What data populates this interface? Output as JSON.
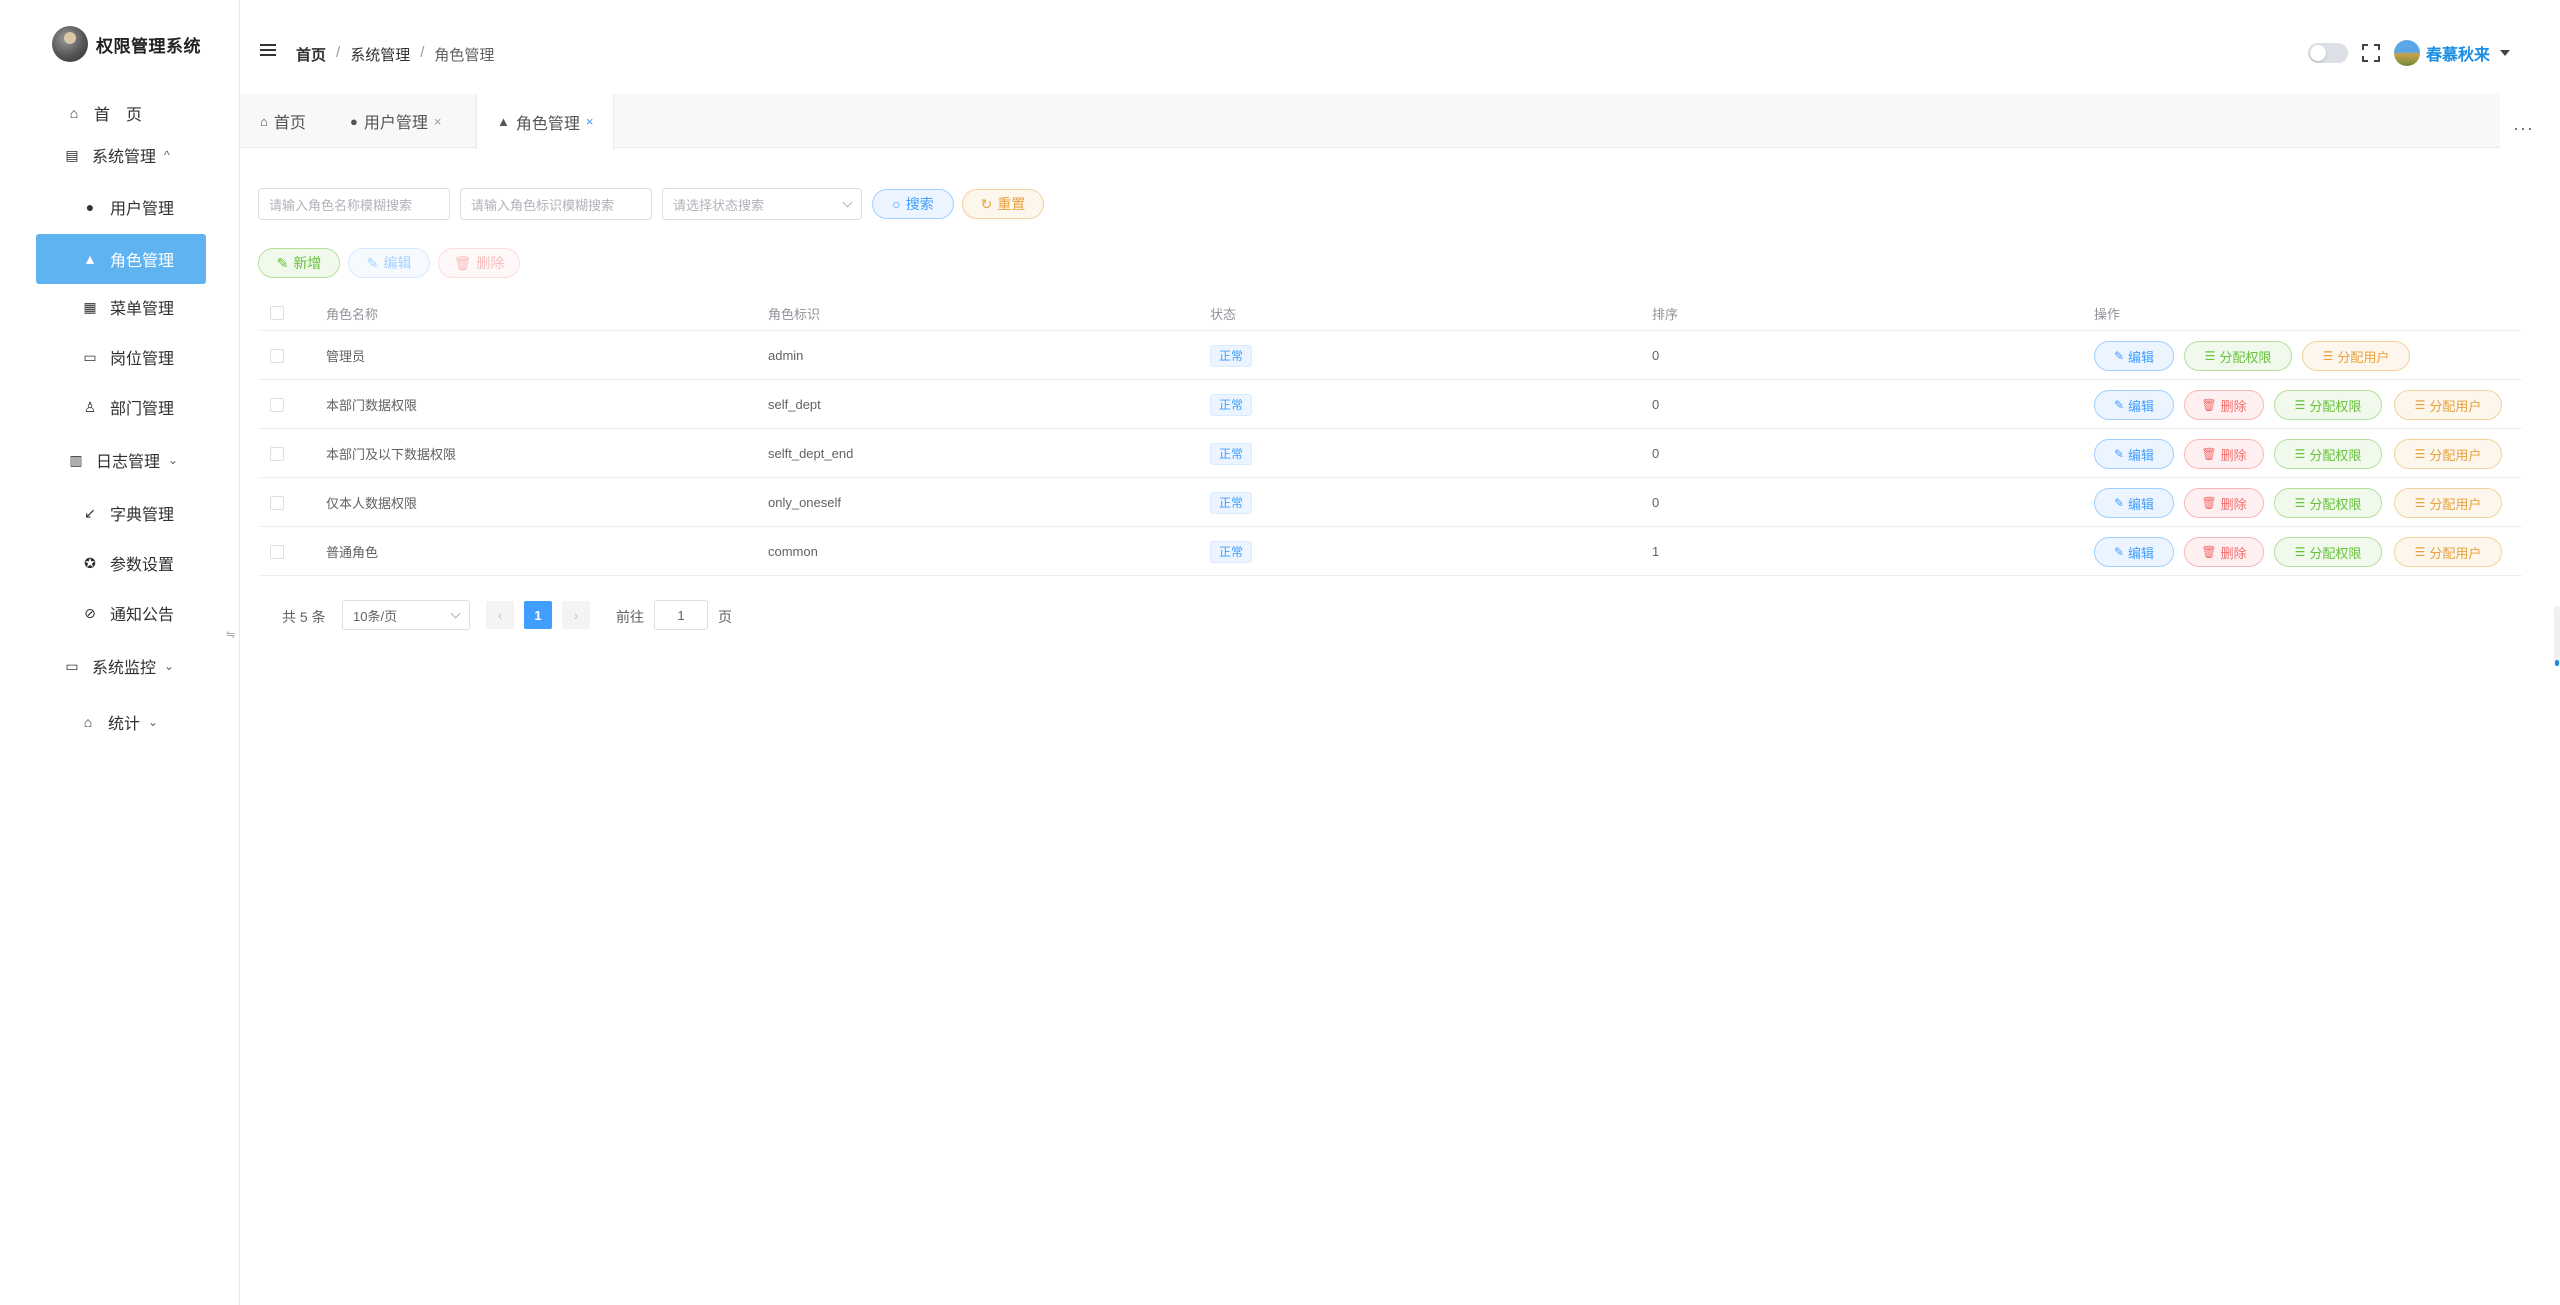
{
  "app": {
    "title": "权限管理系统"
  },
  "sidebar": {
    "items": [
      {
        "label": "首　页",
        "icon": "home-icon"
      },
      {
        "label": "系统管理",
        "icon": "system-icon",
        "arrow": "^"
      },
      {
        "label": "用户管理",
        "icon": "user-icon"
      },
      {
        "label": "角色管理",
        "icon": "role-icon"
      },
      {
        "label": "菜单管理",
        "icon": "menu-grid-icon"
      },
      {
        "label": "岗位管理",
        "icon": "post-icon"
      },
      {
        "label": "部门管理",
        "icon": "dept-icon"
      },
      {
        "label": "日志管理",
        "icon": "calendar-icon",
        "arrow": "⌄"
      },
      {
        "label": "字典管理",
        "icon": "dict-icon"
      },
      {
        "label": "参数设置",
        "icon": "settings-icon"
      },
      {
        "label": "通知公告",
        "icon": "notice-icon"
      },
      {
        "label": "系统监控",
        "icon": "monitor-icon",
        "arrow": "⌄"
      },
      {
        "label": "统计",
        "icon": "stats-icon",
        "arrow": "⌄"
      }
    ]
  },
  "header": {
    "breadcrumb": [
      "首页",
      "系统管理",
      "角色管理"
    ],
    "user_name": "春慕秋来"
  },
  "tabs": [
    {
      "label": "首页",
      "icon": "home-icon"
    },
    {
      "label": "用户管理",
      "icon": "user-icon",
      "close": "×"
    },
    {
      "label": "角色管理",
      "icon": "role-icon",
      "close": "×"
    }
  ],
  "search": {
    "name_placeholder": "请输入角色名称模糊搜索",
    "key_placeholder": "请输入角色标识模糊搜索",
    "status_placeholder": "请选择状态搜索",
    "search_label": "搜索",
    "reset_label": "重置"
  },
  "toolbar": {
    "add_label": "新增",
    "edit_label": "编辑",
    "delete_label": "删除"
  },
  "table": {
    "headers": [
      "角色名称",
      "角色标识",
      "状态",
      "排序",
      "操作"
    ],
    "rows": [
      {
        "name": "管理员",
        "key": "admin",
        "status": "正常",
        "sort": "0"
      },
      {
        "name": "本部门数据权限",
        "key": "self_dept",
        "status": "正常",
        "sort": "0"
      },
      {
        "name": "本部门及以下数据权限",
        "key": "selft_dept_end",
        "status": "正常",
        "sort": "0"
      },
      {
        "name": "仅本人数据权限",
        "key": "only_oneself",
        "status": "正常",
        "sort": "0"
      },
      {
        "name": "普通角色",
        "key": "common",
        "status": "正常",
        "sort": "1"
      }
    ],
    "ops": {
      "edit": "编辑",
      "delete": "删除",
      "assign_perm": "分配权限",
      "assign_user": "分配用户"
    }
  },
  "pagination": {
    "total": "共 5 条",
    "page_size": "10条/页",
    "current": "1",
    "goto": "前往",
    "jump_value": "1",
    "unit": "页"
  },
  "colors": {
    "accent": "#409eff",
    "sidebar_active": "#5fb3f0",
    "success": "#67c23a",
    "danger": "#f56c6c",
    "warning": "#e6a23c"
  }
}
